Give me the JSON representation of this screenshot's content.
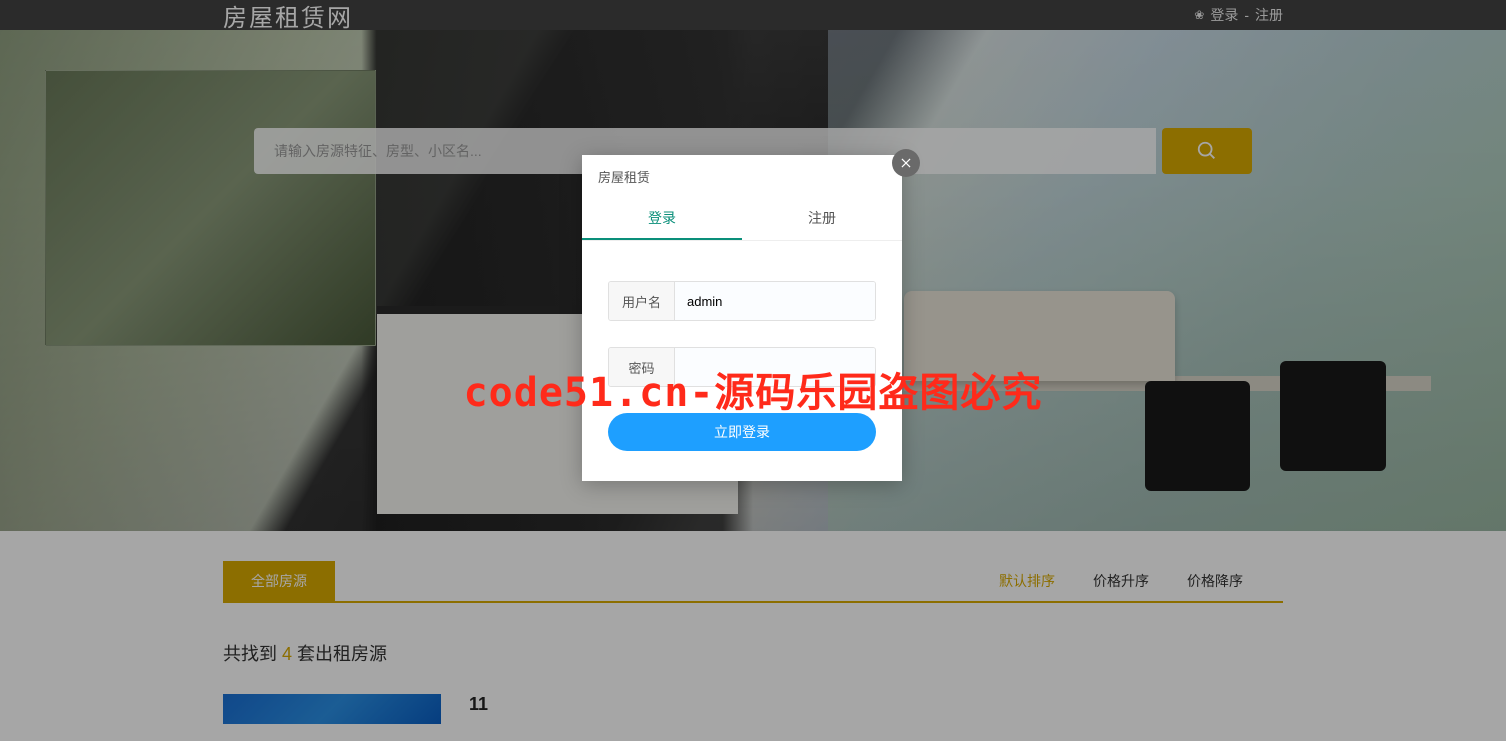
{
  "header": {
    "brand": "房屋租赁网",
    "login_link": "登录",
    "register_link": "注册",
    "separator": "-"
  },
  "search": {
    "placeholder": "请输入房源特征、房型、小区名...",
    "value": ""
  },
  "watermark": "code51.cn-源码乐园盗图必究",
  "tabs": {
    "all_label": "全部房源"
  },
  "sort": {
    "items": [
      {
        "label": "默认排序",
        "active": true
      },
      {
        "label": "价格升序",
        "active": false
      },
      {
        "label": "价格降序",
        "active": false
      }
    ]
  },
  "results": {
    "prefix": "共找到 ",
    "count": "4",
    "suffix": " 套出租房源"
  },
  "listing": {
    "title": "11"
  },
  "modal": {
    "title": "房屋租赁",
    "tab_login": "登录",
    "tab_register": "注册",
    "username_label": "用户名",
    "username_value": "admin",
    "password_label": "密码",
    "password_value": "",
    "submit_label": "立即登录"
  }
}
